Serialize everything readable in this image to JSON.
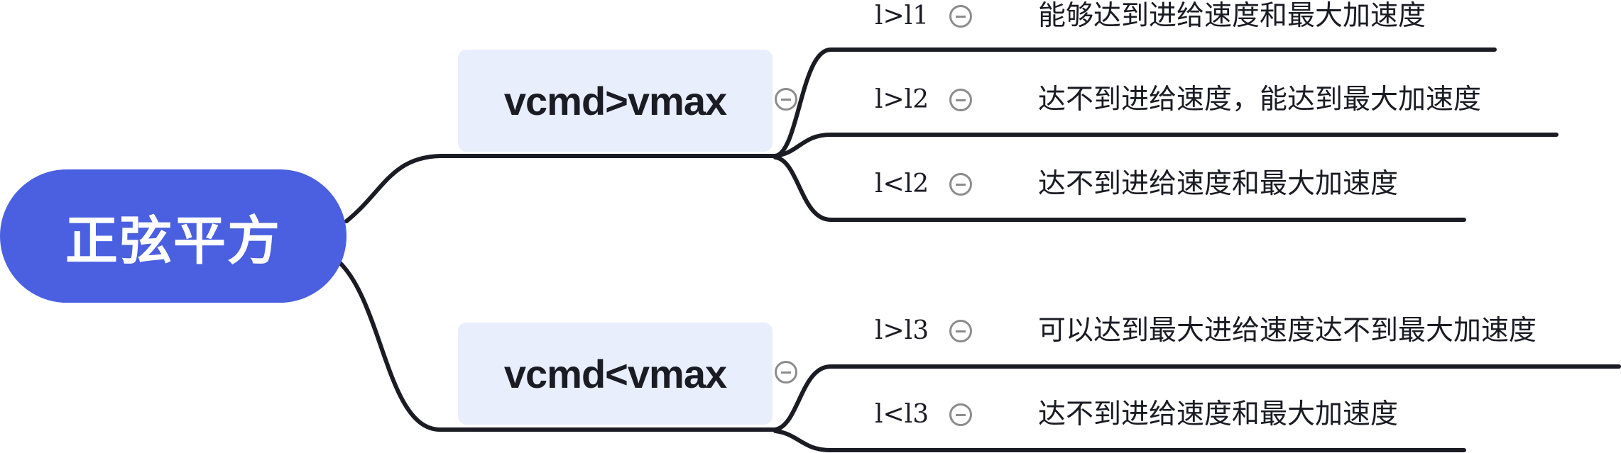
{
  "root": {
    "label": "正弦平方"
  },
  "branches": [
    {
      "label": "vcmd>vmax",
      "leaves": [
        {
          "condition": "l>l1",
          "description": "能够达到进给速度和最大加速度"
        },
        {
          "condition": "l>l2",
          "description": "达不到进给速度，能达到最大加速度"
        },
        {
          "condition": "l<l2",
          "description": "达不到进给速度和最大加速度"
        }
      ]
    },
    {
      "label": "vcmd<vmax",
      "leaves": [
        {
          "condition": "l>l3",
          "description": "可以达到最大进给速度达不到最大加速度"
        },
        {
          "condition": "l<l3",
          "description": "达不到进给速度和最大加速度"
        }
      ]
    }
  ],
  "colors": {
    "root_fill": "#4a60e0",
    "branch_fill": "#e8eefc",
    "connector": "#1b1b24",
    "collapse_icon": "#8c8c8c"
  }
}
